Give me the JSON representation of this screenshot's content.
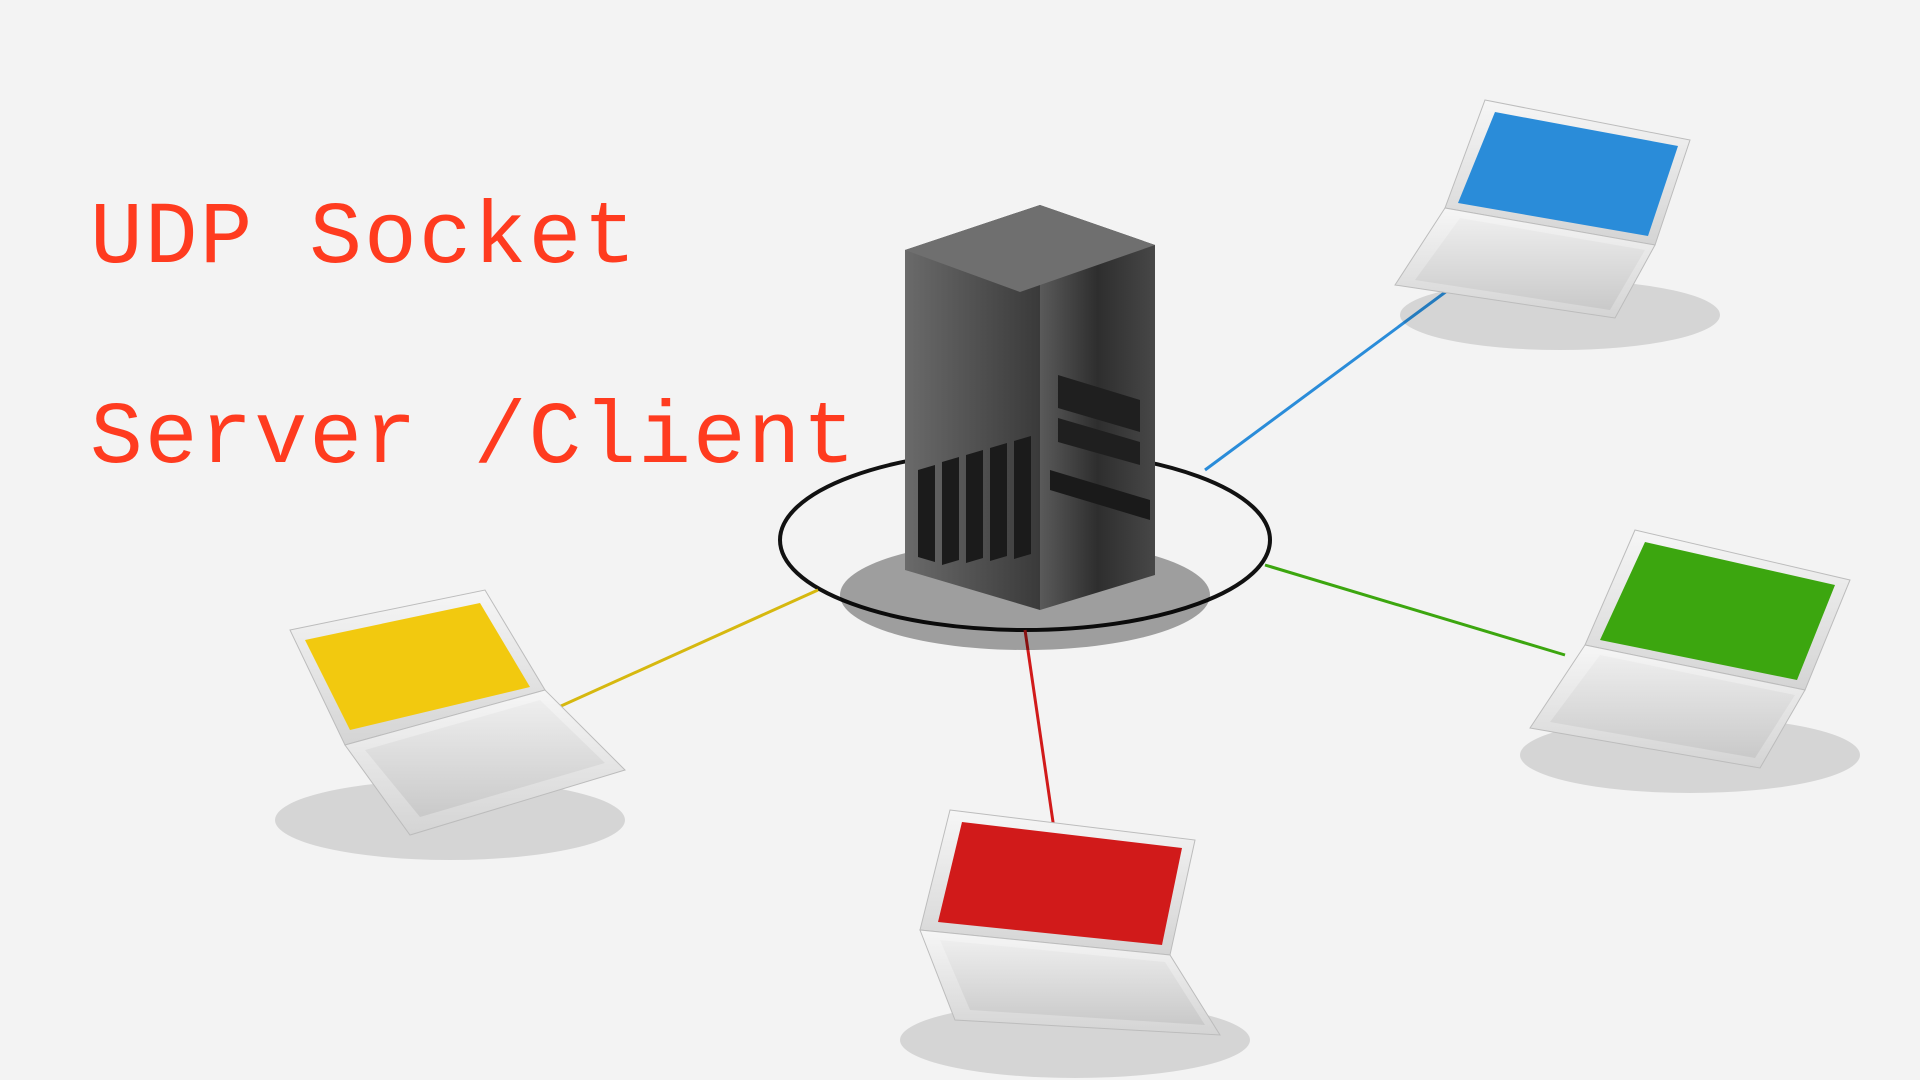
{
  "title": {
    "line1": "UDP Socket",
    "line2": "Server /Client"
  },
  "diagram": {
    "server": {
      "label": "server",
      "color": "#3a3a3a"
    },
    "clients": [
      {
        "label": "yellow-laptop",
        "screen": "#f2c90f",
        "wire": "#d6b80f"
      },
      {
        "label": "red-laptop",
        "screen": "#d11a1a",
        "wire": "#d11a1a"
      },
      {
        "label": "green-laptop",
        "screen": "#3ca60f",
        "wire": "#3ca60f"
      },
      {
        "label": "blue-laptop",
        "screen": "#2a8cd9",
        "wire": "#2a8cd9"
      }
    ]
  }
}
